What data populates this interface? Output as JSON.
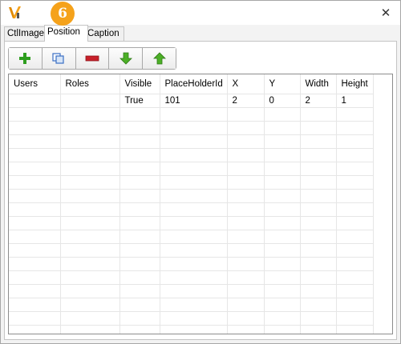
{
  "step_badge": "6",
  "window": {
    "close_glyph": "✕"
  },
  "tabs": [
    {
      "label": "CtlImage",
      "active": false
    },
    {
      "label": "Position",
      "active": true
    },
    {
      "label": "Caption",
      "active": false
    }
  ],
  "toolbar": {
    "buttons": [
      {
        "icon": "add-icon",
        "color": "#2e9e1f"
      },
      {
        "icon": "copy-icon",
        "color": "#3a6fc4"
      },
      {
        "icon": "remove-icon",
        "color": "#c8202a"
      },
      {
        "icon": "move-down-icon",
        "color": "#4caf27"
      },
      {
        "icon": "move-up-icon",
        "color": "#4caf27"
      }
    ]
  },
  "grid": {
    "columns": [
      "Users",
      "Roles",
      "Visible",
      "PlaceHolderId",
      "X",
      "Y",
      "Width",
      "Height"
    ],
    "rows": [
      [
        "",
        "",
        "True",
        "101",
        "2",
        "0",
        "2",
        "1"
      ]
    ]
  },
  "colors": {
    "badge": "#f5a21b",
    "accent": "#f5a21b"
  }
}
